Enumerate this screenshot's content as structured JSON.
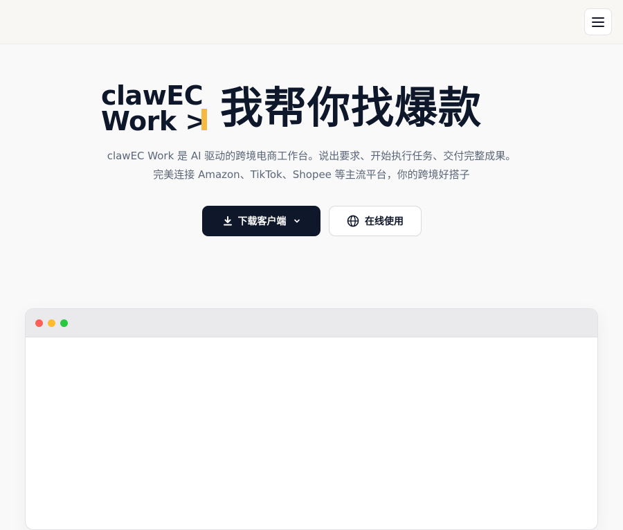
{
  "header": {
    "menu_icon": "hamburger-menu-icon"
  },
  "hero": {
    "logo_line1": "clawEC",
    "logo_line2": "Work >",
    "title": "我帮你找爆款",
    "subtitle_line1": "clawEC Work 是 AI 驱动的跨境电商工作台。说出要求、开始执行任务、交付完整成果。",
    "subtitle_line2": "完美连接 Amazon、TikTok、Shopee 等主流平台，你的跨境好搭子"
  },
  "actions": {
    "download_label": "下载客户端",
    "download_icon": "download-icon",
    "download_chevron_icon": "chevron-down-icon",
    "online_label": "在线使用",
    "online_icon": "globe-icon"
  },
  "preview_window": {
    "controls": [
      "close",
      "minimize",
      "maximize"
    ],
    "colors": {
      "close": "#fe5f57",
      "minimize": "#febc2e",
      "maximize": "#28c840"
    }
  },
  "colors": {
    "accent": "#f5b942",
    "primary": "#0f172a"
  }
}
